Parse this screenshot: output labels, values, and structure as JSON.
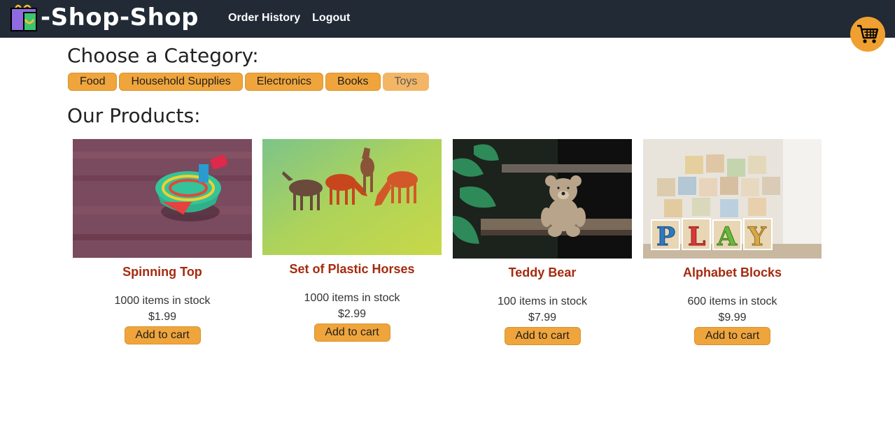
{
  "header": {
    "brand": "-Shop-Shop",
    "nav": [
      {
        "label": "Order History"
      },
      {
        "label": "Logout"
      }
    ],
    "cart_icon": "shopping-cart-icon"
  },
  "categories": {
    "heading": "Choose a Category:",
    "items": [
      {
        "label": "Food",
        "active": false
      },
      {
        "label": "Household Supplies",
        "active": false
      },
      {
        "label": "Electronics",
        "active": false
      },
      {
        "label": "Books",
        "active": false
      },
      {
        "label": "Toys",
        "active": true
      }
    ]
  },
  "products": {
    "heading": "Our Products:",
    "items": [
      {
        "name": "Spinning Top",
        "stock": "1000 items in stock",
        "price": "$1.99",
        "button": "Add to cart"
      },
      {
        "name": "Set of Plastic Horses",
        "stock": "1000 items in stock",
        "price": "$2.99",
        "button": "Add to cart"
      },
      {
        "name": "Teddy Bear",
        "stock": "100 items in stock",
        "price": "$7.99",
        "button": "Add to cart"
      },
      {
        "name": "Alphabet Blocks",
        "stock": "600 items in stock",
        "price": "$9.99",
        "button": "Add to cart"
      }
    ]
  },
  "colors": {
    "header_bg": "#222a36",
    "accent": "#efa53c",
    "product_name": "#a52a0f"
  }
}
